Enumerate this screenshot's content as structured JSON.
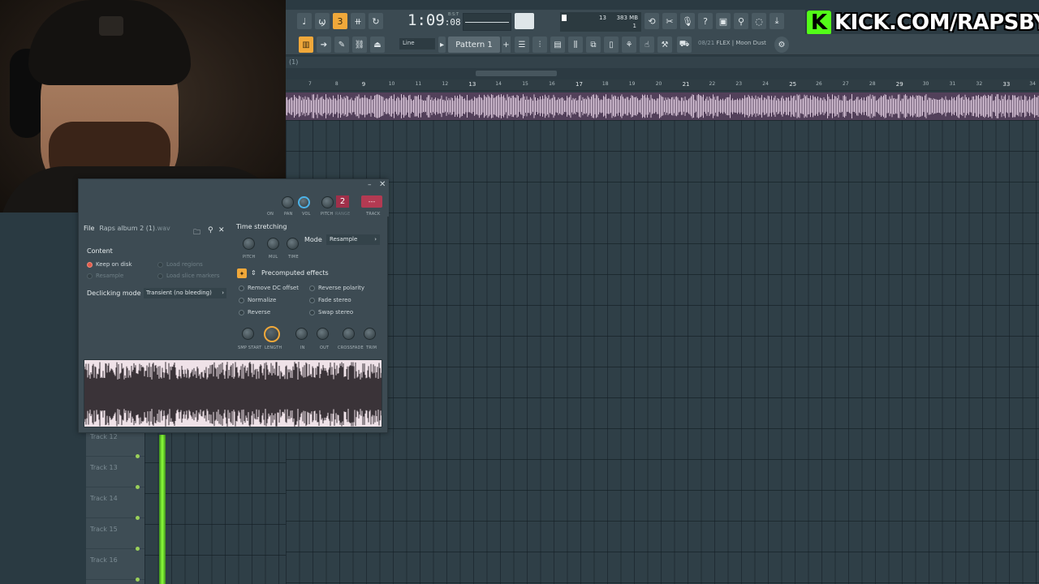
{
  "stream": {
    "banner_text": "KICK.COM/RAPSBYRC",
    "brand_color": "#53fc18"
  },
  "transport": {
    "time_main": "1:09",
    "time_sub": ":08",
    "time_label": "B:S:T",
    "cpu_value": "13",
    "ram_value": "383 MB",
    "poly_value": "1"
  },
  "toolbar": {
    "snap": "Line",
    "pattern": "Pattern 1",
    "pattern_add": "+",
    "hint_index": "08/21",
    "hint_text": "FLEX | Moon Dust"
  },
  "playlist": {
    "title": "(1)",
    "ruler_ticks": [
      "7",
      "8",
      "9",
      "10",
      "11",
      "12",
      "13",
      "14",
      "15",
      "16",
      "17",
      "18",
      "19",
      "20",
      "21",
      "22",
      "23",
      "24",
      "25",
      "26",
      "27",
      "28",
      "29",
      "30",
      "31",
      "32",
      "33",
      "34"
    ]
  },
  "tracks": [
    "Track 12",
    "Track 13",
    "Track 14",
    "Track 15",
    "Track 16"
  ],
  "channel_settings": {
    "win_min": "–",
    "win_close": "✕",
    "knob_labels": {
      "on": "ON",
      "pan": "PAN",
      "vol": "VOL",
      "pitch": "PITCH",
      "range": "RANGE",
      "track": "TRACK"
    },
    "range_value": "2",
    "track_value": "---",
    "file_label": "File",
    "file_name": "Raps album 2 (1)",
    "file_ext": ".wav",
    "content_label": "Content",
    "keep_on_disk": "Keep on disk",
    "resample": "Resample",
    "load_regions": "Load regions",
    "load_slice_markers": "Load slice markers",
    "declicking_label": "Declicking mode",
    "declicking_value": "Transient (no bleeding)",
    "time_stretching_label": "Time stretching",
    "ts_knobs": [
      "PITCH",
      "MUL",
      "TIME"
    ],
    "mode_label": "Mode",
    "mode_value": "Resample",
    "precomputed_label": "Precomputed effects",
    "effects_left": [
      "Remove DC offset",
      "Normalize",
      "Reverse"
    ],
    "effects_right": [
      "Reverse polarity",
      "Fade stereo",
      "Swap stereo"
    ],
    "bottom_knobs": [
      "SMP START",
      "LENGTH",
      "IN",
      "OUT",
      "CROSSFADE",
      "TRIM"
    ]
  },
  "colors": {
    "accent": "#f0a83a",
    "playhead": "#8cff3a",
    "waveform": "#efe2e8",
    "track_color": "#b33a52"
  }
}
